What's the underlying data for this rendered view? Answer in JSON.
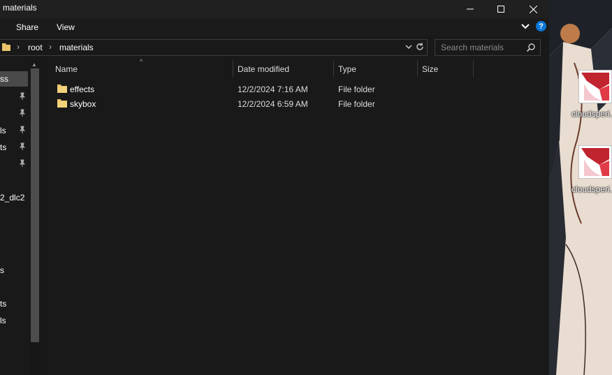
{
  "window": {
    "title": "materials",
    "minimize_glyph": "—",
    "maximize_glyph": "☐",
    "close_glyph": "✕"
  },
  "ribbon": {
    "tabs": [
      "Share",
      "View"
    ],
    "help_glyph": "?"
  },
  "address": {
    "crumbs": [
      "root",
      "materials"
    ],
    "search_placeholder": "Search materials"
  },
  "nav_pane": {
    "items": [
      {
        "label": "ss",
        "pinned": false
      },
      {
        "label": "",
        "pinned": true
      },
      {
        "label": "",
        "pinned": true
      },
      {
        "label": "ls",
        "pinned": true
      },
      {
        "label": "ts",
        "pinned": true
      },
      {
        "label": "",
        "pinned": true
      },
      {
        "label": "2_dlc2",
        "pinned": false
      },
      {
        "label": "s",
        "pinned": false
      },
      {
        "label": "ts",
        "pinned": false
      },
      {
        "label": "ls",
        "pinned": false
      }
    ]
  },
  "file_list": {
    "columns": [
      "Name",
      "Date modified",
      "Type",
      "Size"
    ],
    "rows": [
      {
        "name": "effects",
        "date": "12/2/2024 7:16 AM",
        "type": "File folder",
        "size": ""
      },
      {
        "name": "skybox",
        "date": "12/2/2024 6:59 AM",
        "type": "File folder",
        "size": ""
      }
    ]
  },
  "desktop": {
    "icons": [
      {
        "label": "cloudsperi..."
      },
      {
        "label": "cloudsperi..."
      }
    ]
  },
  "colors": {
    "folder": "#e9c46a",
    "accent": "#0a78d7",
    "background": "#191919"
  }
}
